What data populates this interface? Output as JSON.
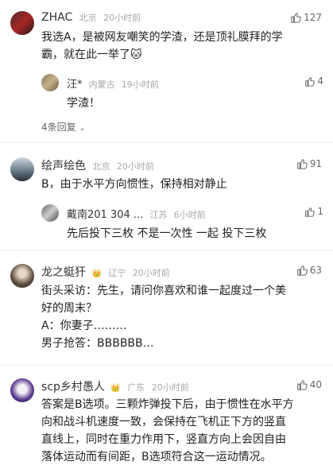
{
  "comments": [
    {
      "name": "ZHAC",
      "location": "北京",
      "time": "20小时前",
      "likes": "127",
      "text_lines": [
        "我选A，是被网友嘲笑的学渣，还是顶礼膜拜的学",
        "霸，就在此一举了🐱"
      ],
      "reply": {
        "name": "汪*",
        "location": "内蒙古",
        "time": "19小时前",
        "likes": "4",
        "text": "学渣！"
      },
      "more_replies": "4条回复"
    },
    {
      "name": "绘声绘色",
      "location": "北京",
      "time": "20小时前",
      "likes": "91",
      "text_lines": [
        "B，由于水平方向惯性，保持相对静止"
      ],
      "reply": {
        "name": "戴南201 304 ...",
        "location": "江苏",
        "time": "6小时前",
        "likes": "1",
        "text": "先后投下三枚 不是一次性 一起 投下三枚"
      }
    },
    {
      "name": "龙之蜓犴",
      "location": "辽宁",
      "time": "20小时前",
      "likes": "63",
      "text_lines": [
        "街头采访：先生，请问你喜欢和谁一起度过一个美",
        "好的周末？",
        "A：你妻子………",
        "男子抢答：BBBBBB…"
      ]
    },
    {
      "name": "scp乡村愚人",
      "location": "广东",
      "time": "20小时前",
      "likes": "40",
      "text_lines": [
        "答案是B选项。三颗炸弹投下后，由于惯性在水平方",
        "向和战斗机速度一致，会保持在飞机正下方的竖直",
        "直线上，同时在重力作用下，竖直方向上会因自由",
        "落体运动而有间距，B选项符合这一运动情况。"
      ]
    }
  ]
}
